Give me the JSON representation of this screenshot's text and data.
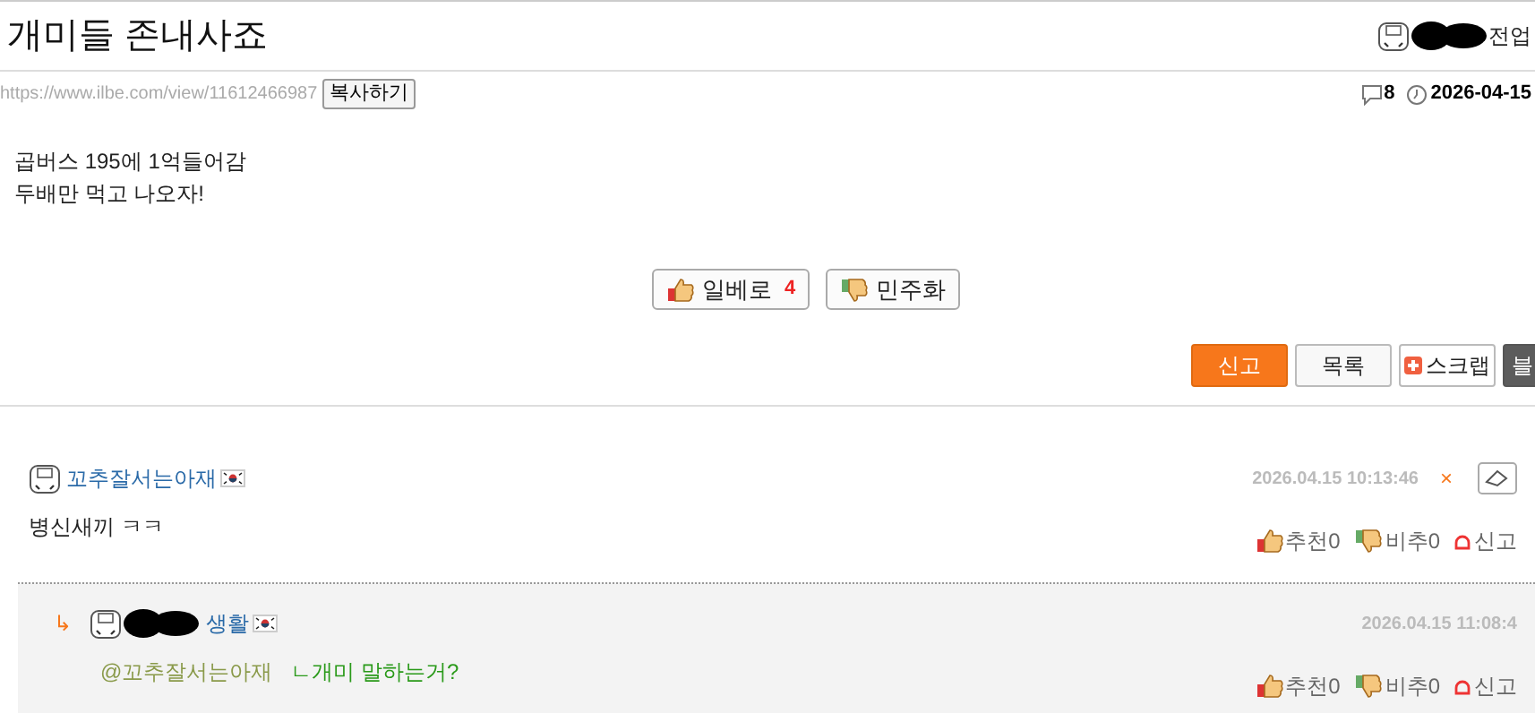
{
  "post": {
    "title": "개미들 존내사죠",
    "author_name": "전업",
    "url": "https://www.ilbe.com/view/11612466987",
    "copy_button": "복사하기",
    "comment_count": "8",
    "date": "2026-04-15",
    "body": [
      "곱버스 195에 1억들어감",
      "두배만 먹고 나오자!"
    ]
  },
  "votes": [
    {
      "kind": "up",
      "label": "일베로",
      "count": "4"
    },
    {
      "kind": "down",
      "label": "민주화"
    }
  ],
  "actions": [
    {
      "kind": "primary",
      "label": "신고"
    },
    {
      "kind": "plain",
      "label": "목록"
    },
    {
      "kind": "scrap",
      "label": "스크랩"
    },
    {
      "kind": "dark",
      "label": "블"
    }
  ],
  "comments": [
    {
      "kind": "comment",
      "name": "꼬추잘서는아재",
      "name_redacted": false,
      "time": "2026.04.15 10:13:46",
      "deletable": true,
      "delete_icon": "×",
      "text": "병신새끼 ㅋㅋ",
      "recommend": "추천0",
      "oppose": "비추0",
      "report": "신고"
    },
    {
      "kind": "reply",
      "reply_arrow": "↳",
      "name": "생활",
      "name_redacted": true,
      "time": "2026.04.15 11:08:4",
      "deletable": false,
      "mention": "@꼬추잘서는아재",
      "text": "ㄴ개미 말하는거?",
      "recommend": "추천0",
      "oppose": "비추0",
      "report": "신고"
    }
  ]
}
